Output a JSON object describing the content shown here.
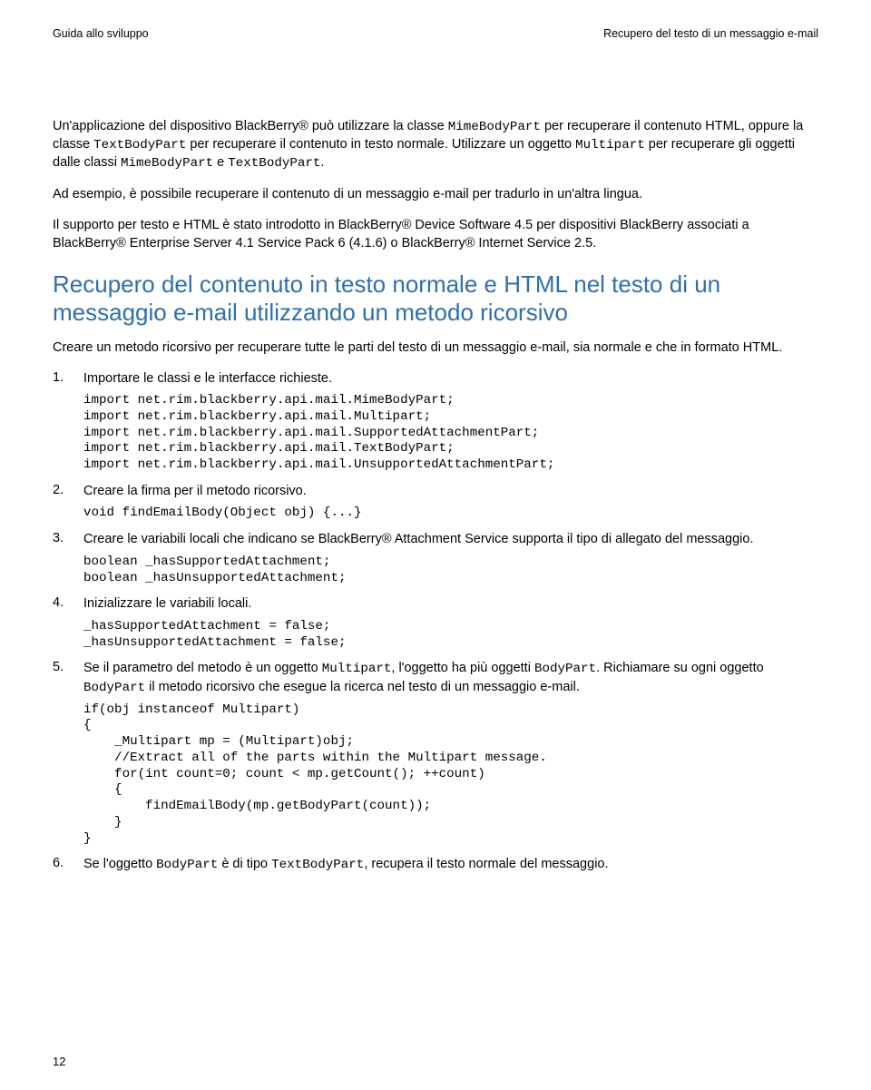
{
  "header": {
    "left": "Guida allo sviluppo",
    "right": "Recupero del testo di un messaggio e-mail"
  },
  "paragraphs": {
    "p1_a": "Un'applicazione del dispositivo BlackBerry® può utilizzare la classe ",
    "p1_mono1": "MimeBodyPart",
    "p1_b": " per recuperare il contenuto HTML, oppure la classe ",
    "p1_mono2": "TextBodyPart",
    "p1_c": " per recuperare il contenuto in testo normale. Utilizzare un oggetto ",
    "p1_mono3": "Multipart",
    "p1_d": " per recuperare gli oggetti dalle classi ",
    "p1_mono4": "MimeBodyPart",
    "p1_e": " e ",
    "p1_mono5": "TextBodyPart",
    "p1_f": ".",
    "p2": "Ad esempio, è possibile recuperare il contenuto di un messaggio e-mail per tradurlo in un'altra lingua.",
    "p3": "Il supporto per testo e HTML è stato introdotto in BlackBerry® Device Software 4.5 per dispositivi BlackBerry associati a BlackBerry® Enterprise Server 4.1 Service Pack 6 (4.1.6) o BlackBerry® Internet Service 2.5."
  },
  "section_title": "Recupero del contenuto in testo normale e HTML nel testo di un messaggio e-mail utilizzando un metodo ricorsivo",
  "section_intro": "Creare un metodo ricorsivo per recuperare tutte le parti del testo di un messaggio e-mail, sia normale e che in formato HTML.",
  "steps": [
    {
      "text": "Importare le classi e le interfacce richieste.",
      "code": "import net.rim.blackberry.api.mail.MimeBodyPart;\nimport net.rim.blackberry.api.mail.Multipart;\nimport net.rim.blackberry.api.mail.SupportedAttachmentPart;\nimport net.rim.blackberry.api.mail.TextBodyPart;\nimport net.rim.blackberry.api.mail.UnsupportedAttachmentPart;"
    },
    {
      "text": "Creare la firma per il metodo ricorsivo.",
      "code": "void findEmailBody(Object obj) {...}"
    },
    {
      "text": "Creare le variabili locali che indicano se BlackBerry® Attachment Service supporta il tipo di allegato del messaggio.",
      "code": "boolean _hasSupportedAttachment;\nboolean _hasUnsupportedAttachment;"
    },
    {
      "text": "Inizializzare le variabili locali.",
      "code": "_hasSupportedAttachment = false;\n_hasUnsupportedAttachment = false;"
    },
    {
      "text_a": "Se il parametro del metodo è un oggetto ",
      "mono1": "Multipart",
      "text_b": ", l'oggetto ha più oggetti ",
      "mono2": "BodyPart",
      "text_c": ". Richiamare su ogni oggetto ",
      "mono3": "BodyPart",
      "text_d": " il metodo ricorsivo che esegue la ricerca nel testo di un messaggio e-mail.",
      "code": "if(obj instanceof Multipart)\n{\n    _Multipart mp = (Multipart)obj;\n    //Extract all of the parts within the Multipart message.\n    for(int count=0; count < mp.getCount(); ++count)\n    {\n        findEmailBody(mp.getBodyPart(count));\n    }\n}"
    },
    {
      "text_a": "Se l'oggetto ",
      "mono1": "BodyPart",
      "text_b": " è di tipo ",
      "mono2": "TextBodyPart",
      "text_c": ", recupera il testo normale del messaggio."
    }
  ],
  "page_number": "12"
}
